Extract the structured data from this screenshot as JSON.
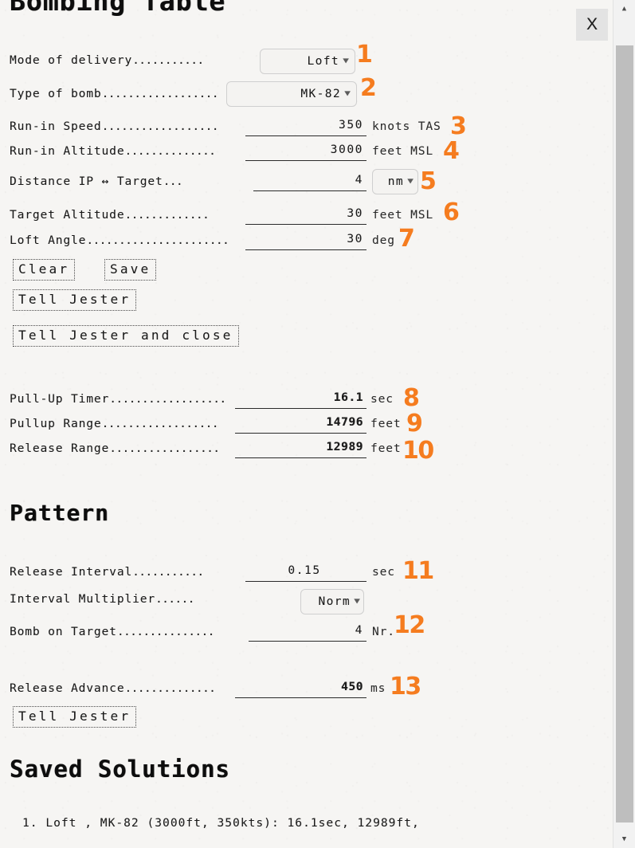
{
  "window": {
    "title": "Bombing Table",
    "close_label": "X"
  },
  "sections": {
    "pattern_heading": "Pattern",
    "saved_heading": "Saved Solutions"
  },
  "inputs": {
    "mode_of_delivery": {
      "label": "Mode of delivery",
      "dots": "...........",
      "value": "Loft",
      "type": "dropdown",
      "annotation": "1"
    },
    "type_of_bomb": {
      "label": "Type of bomb",
      "dots": "..................",
      "value": "MK-82",
      "type": "dropdown",
      "annotation": "2"
    },
    "run_in_speed": {
      "label": "Run-in Speed",
      "dots": "..................",
      "value": "350",
      "unit": "knots TAS",
      "annotation": "3"
    },
    "run_in_altitude": {
      "label": "Run-in Altitude",
      "dots": "..............",
      "value": "3000",
      "unit": "feet MSL",
      "annotation": "4"
    },
    "distance_ip_target": {
      "label": "Distance IP ↔ Target",
      "dots": "...",
      "value": "4",
      "unit_value": "nm",
      "unit_type": "dropdown",
      "annotation": "5"
    },
    "target_altitude": {
      "label": "Target Altitude",
      "dots": ".............",
      "value": "30",
      "unit": "feet MSL",
      "annotation": "6"
    },
    "loft_angle": {
      "label": "Loft Angle",
      "dots": "......................",
      "value": "30",
      "unit": "deg",
      "annotation": "7"
    }
  },
  "buttons": {
    "clear": "Clear",
    "save": "Save",
    "tell_jester": "Tell Jester",
    "tell_jester_and_close": "Tell Jester and close",
    "pattern_tell_jester": "Tell Jester"
  },
  "results": {
    "pull_up_timer": {
      "label": "Pull-Up Timer",
      "dots": "..................",
      "value": "16.1",
      "unit": "sec",
      "annotation": "8"
    },
    "pullup_range": {
      "label": "Pullup Range",
      "dots": "..................",
      "value": "14796",
      "unit": "feet",
      "annotation": "9"
    },
    "release_range": {
      "label": "Release Range",
      "dots": ".................",
      "value": "12989",
      "unit": "feet",
      "annotation": "10"
    }
  },
  "pattern": {
    "release_interval": {
      "label": "Release Interval",
      "dots": "...........",
      "value": "0.15",
      "unit": "sec",
      "annotation": "11"
    },
    "interval_multiplier": {
      "label": "Interval Multiplier",
      "dots": "......",
      "value": "Norm",
      "type": "dropdown"
    },
    "bomb_on_target": {
      "label": "Bomb on Target",
      "dots": "...............",
      "value": "4",
      "unit": "Nr.",
      "annotation": "12"
    },
    "release_advance": {
      "label": "Release Advance",
      "dots": "..............",
      "value": "450",
      "unit": "ms",
      "annotation": "13"
    }
  },
  "saved_solutions": [
    "1. Loft , MK-82 (3000ft, 350kts): 16.1sec, 12989ft,"
  ],
  "icons": {
    "caret_down": "▼",
    "scroll_up": "▲",
    "scroll_down": "▼"
  },
  "colors": {
    "annotation": "#F57C1F",
    "paper": "#f6f5f3",
    "ink": "#1a1a1a"
  }
}
